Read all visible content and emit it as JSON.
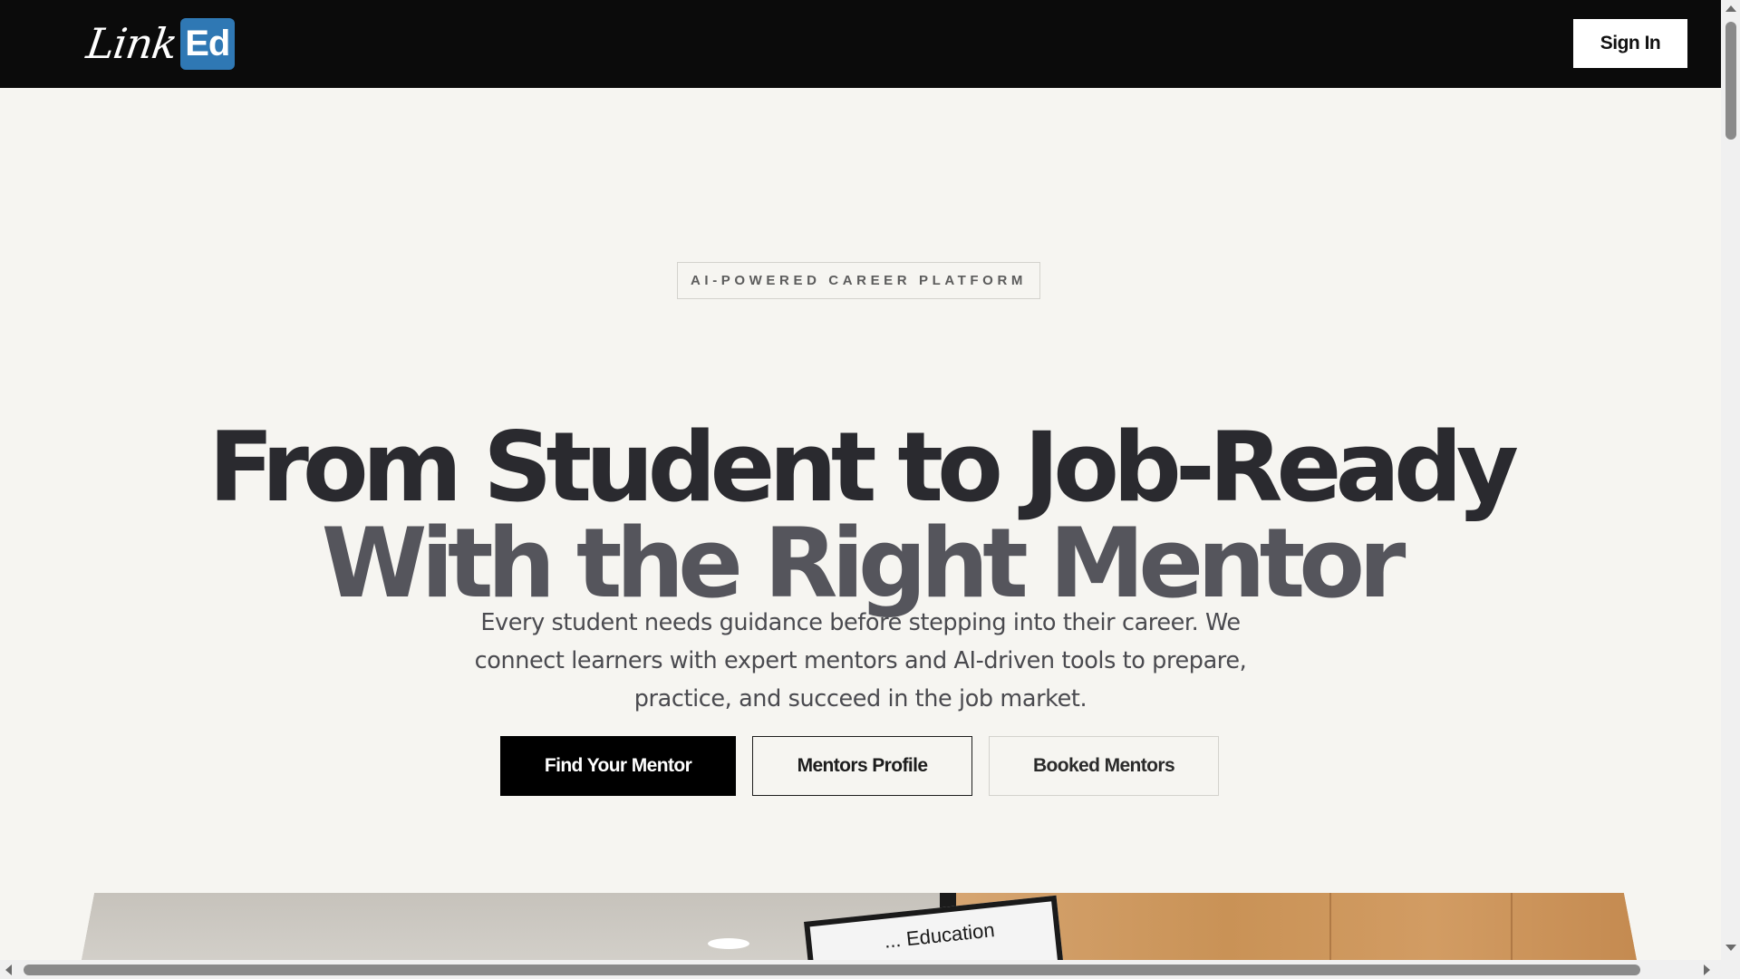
{
  "header": {
    "logo_script": "Link",
    "logo_box": "Ed",
    "signin_label": "Sign In"
  },
  "hero": {
    "badge": "AI-POWERED CAREER PLATFORM",
    "headline_line1": "From Student to Job-Ready",
    "headline_line2": "With the Right Mentor",
    "description": "Every student needs guidance before stepping into their career. We connect learners with expert mentors and AI-driven tools to prepare, practice, and succeed in the job market.",
    "buttons": {
      "find_mentor": "Find Your Mentor",
      "mentors_profile": "Mentors Profile",
      "booked_mentors": "Booked Mentors"
    }
  },
  "photo": {
    "sign_text": "... Education"
  },
  "colors": {
    "nav_bg": "#0b0b0b",
    "page_bg": "#f6f5f1",
    "logo_accent": "#2f78b4",
    "primary_button": "#000000",
    "headline_dark": "#2a2a2f",
    "headline_gray": "#55555c"
  },
  "icons": {
    "scroll_up": "triangle-up",
    "scroll_down": "triangle-down",
    "scroll_left": "triangle-left",
    "scroll_right": "triangle-right"
  }
}
